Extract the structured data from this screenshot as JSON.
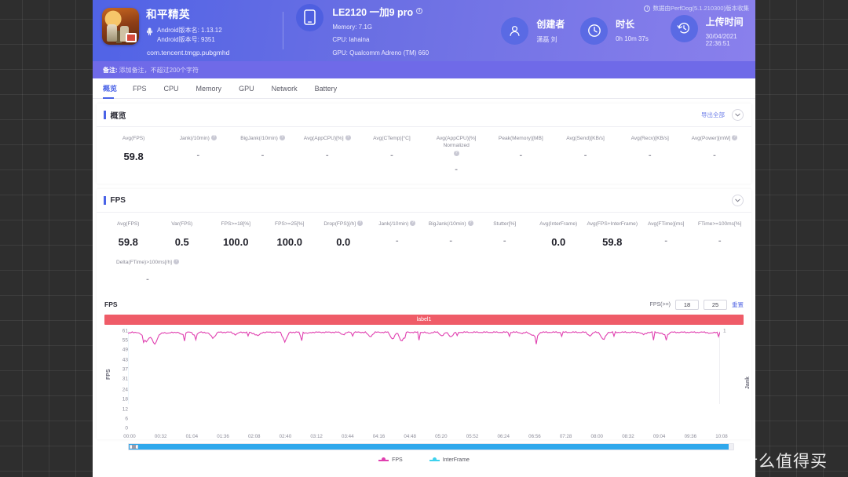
{
  "header": {
    "collect_note": "数据由PerfDog(5.1.210300)版本收集",
    "app": {
      "name": "和平精英",
      "version_name": "Android版本名: 1.13.12",
      "version_code": "Android版本号: 9351",
      "package": "com.tencent.tmgp.pubgmhd"
    },
    "device": {
      "model": "LE2120 一加9 pro",
      "memory": "Memory: 7.1G",
      "cpu": "CPU: lahaina",
      "gpu": "GPU: Qualcomm Adreno (TM) 660"
    },
    "stats": [
      {
        "icon": "user-icon",
        "title": "创建者",
        "value": "潇磊 刘"
      },
      {
        "icon": "clock-icon",
        "title": "时长",
        "value": "0h 10m 37s"
      },
      {
        "icon": "history-icon",
        "title": "上传时间",
        "value": "30/04/2021 22:36:51"
      }
    ],
    "remark_label": "备注:",
    "remark_placeholder": "添加备注，不超过200个字符"
  },
  "tabs": [
    {
      "label": "概览",
      "active": true
    },
    {
      "label": "FPS",
      "active": false
    },
    {
      "label": "CPU",
      "active": false
    },
    {
      "label": "Memory",
      "active": false
    },
    {
      "label": "GPU",
      "active": false
    },
    {
      "label": "Network",
      "active": false
    },
    {
      "label": "Battery",
      "active": false
    }
  ],
  "overview": {
    "title": "概览",
    "export_label": "导出全部",
    "metrics": [
      {
        "label": "Avg(FPS)",
        "help": false,
        "value": "59.8"
      },
      {
        "label": "Jank(/10min)",
        "help": true,
        "value": "-"
      },
      {
        "label": "BigJank(/10min)",
        "help": true,
        "value": "-"
      },
      {
        "label": "Avg(AppCPU)[%]",
        "help": true,
        "value": "-"
      },
      {
        "label": "Avg(CTemp)[°C]",
        "help": false,
        "value": "-"
      },
      {
        "label": "Avg(AppCPU)[%] Normalized",
        "help": true,
        "value": "-"
      },
      {
        "label": "Peak(Memory)[MB]",
        "help": false,
        "value": "-"
      },
      {
        "label": "Avg(Send)[KB/s]",
        "help": false,
        "value": "-"
      },
      {
        "label": "Avg(Recv)[KB/s]",
        "help": false,
        "value": "-"
      },
      {
        "label": "Avg(Power)[mW]",
        "help": true,
        "value": "-"
      }
    ]
  },
  "fps_panel": {
    "title": "FPS",
    "metrics_row1": [
      {
        "label": "Avg(FPS)",
        "help": false,
        "value": "59.8"
      },
      {
        "label": "Var(FPS)",
        "help": false,
        "value": "0.5"
      },
      {
        "label": "FPS>=18[%]",
        "help": false,
        "value": "100.0"
      },
      {
        "label": "FPS>=25[%]",
        "help": false,
        "value": "100.0"
      },
      {
        "label": "Drop(FPS)[/h]",
        "help": true,
        "value": "0.0"
      },
      {
        "label": "Jank(/10min)",
        "help": true,
        "value": "-"
      },
      {
        "label": "BigJank(/10min)",
        "help": true,
        "value": "-"
      },
      {
        "label": "Stutter[%]",
        "help": false,
        "value": "-"
      },
      {
        "label": "Avg(InterFrame)",
        "help": false,
        "value": "0.0"
      },
      {
        "label": "Avg(FPS+InterFrame)",
        "help": false,
        "value": "59.8"
      },
      {
        "label": "Avg(FTime)[ms]",
        "help": false,
        "value": "-"
      },
      {
        "label": "FTime>=100ms[%]",
        "help": false,
        "value": "-"
      }
    ],
    "metrics_row2": [
      {
        "label": "Delta(FTime)>100ms[/h]",
        "help": true,
        "value": "-"
      }
    ],
    "chart_controls": {
      "chart_label": "FPS",
      "threshold_label": "FPS(>=)",
      "threshold_1": "18",
      "threshold_2": "25",
      "reset_label": "重置"
    },
    "series_label": "label1"
  },
  "chart_data": {
    "type": "line",
    "title": "FPS",
    "xlabel": "",
    "ylabel": "FPS",
    "y2label": "Jank",
    "ylim": [
      0,
      61
    ],
    "y2lim": [
      0,
      1
    ],
    "yticks": [
      61,
      55,
      49,
      43,
      37,
      31,
      24,
      18,
      12,
      6,
      0
    ],
    "y2ticks": [
      1
    ],
    "xticks": [
      "00:00",
      "00:32",
      "01:04",
      "01:36",
      "02:08",
      "02:40",
      "03:12",
      "03:44",
      "04:16",
      "04:48",
      "05:20",
      "05:52",
      "06:24",
      "06:56",
      "07:28",
      "08:00",
      "08:32",
      "09:04",
      "09:36",
      "10:08"
    ],
    "grid": false,
    "legend": [
      {
        "name": "FPS",
        "color": "#e040b0"
      },
      {
        "name": "InterFrame",
        "color": "#3fd2ee"
      }
    ],
    "series": [
      {
        "name": "FPS",
        "color": "#e040b0",
        "note": "Near-constant 60 fps with brief dips",
        "values": [
          59,
          60,
          60,
          58,
          52,
          56,
          50,
          58,
          60,
          59,
          60,
          60,
          58,
          60,
          60,
          57,
          60,
          60,
          59,
          55,
          60,
          60,
          60,
          60,
          58,
          60,
          60,
          60,
          59,
          57,
          60,
          60,
          60,
          60,
          60,
          52,
          60,
          60,
          60,
          60,
          59,
          60,
          60,
          60,
          60,
          60,
          60,
          60,
          58,
          60,
          60,
          60,
          60,
          60,
          56,
          60,
          60,
          60,
          60,
          54,
          60,
          52,
          60,
          60,
          60,
          60,
          60,
          59,
          60,
          60,
          57,
          60,
          56,
          60,
          60,
          60,
          60,
          60,
          60,
          60,
          60,
          60,
          60,
          60,
          60,
          60,
          60,
          60,
          59,
          60,
          58,
          56,
          60,
          60,
          60,
          60,
          60,
          60,
          60,
          60,
          60,
          60,
          60,
          57,
          60,
          60,
          53,
          60,
          60,
          60,
          60,
          60,
          60,
          60,
          60,
          58,
          60,
          60,
          60,
          59,
          57,
          60,
          60,
          60,
          60,
          60,
          60,
          60,
          60,
          60,
          59,
          60,
          60
        ]
      },
      {
        "name": "InterFrame",
        "color": "#3fd2ee",
        "values": [
          0,
          0,
          0,
          0,
          0,
          0,
          0,
          0,
          0,
          0,
          0,
          0,
          0,
          0,
          0,
          0,
          0,
          0,
          0,
          0
        ]
      }
    ]
  },
  "watermark": {
    "text": "什么值得买",
    "mark": "值"
  }
}
